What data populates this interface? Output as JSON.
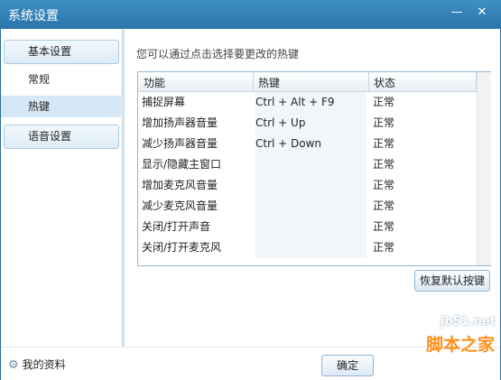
{
  "window": {
    "title": "系统设置",
    "min_icon": "minimize-icon",
    "close_icon": "close-icon"
  },
  "sidebar": {
    "group_basic": "基本设置",
    "items": [
      "常规",
      "热键"
    ],
    "group_voice": "语音设置",
    "selected": "热键"
  },
  "main": {
    "hint": "您可以通过点击选择要更改的热键",
    "table": {
      "headers": [
        "功能",
        "热键",
        "状态"
      ],
      "rows": [
        {
          "function": "捕捉屏幕",
          "hotkey": "Ctrl + Alt + F9",
          "status": "正常"
        },
        {
          "function": "增加扬声器音量",
          "hotkey": "Ctrl + Up",
          "status": "正常"
        },
        {
          "function": "减少扬声器音量",
          "hotkey": "Ctrl + Down",
          "status": "正常"
        },
        {
          "function": "显示/隐藏主窗口",
          "hotkey": "",
          "status": "正常"
        },
        {
          "function": "增加麦克风音量",
          "hotkey": "",
          "status": "正常"
        },
        {
          "function": "减少麦克风音量",
          "hotkey": "",
          "status": "正常"
        },
        {
          "function": "关闭/打开声音",
          "hotkey": "",
          "status": "正常"
        },
        {
          "function": "关闭/打开麦克风",
          "hotkey": "",
          "status": "正常"
        }
      ]
    },
    "restore_button": "恢复默认按键"
  },
  "footer": {
    "profile_link": "我的资料",
    "profile_icon": "gear-icon",
    "ok_button": "确定"
  },
  "watermark": {
    "line1": "jb51.net",
    "line2": "脚本之家"
  },
  "colors": {
    "titlebar": "#2a75ab",
    "selected_item": "#d6e8f6",
    "watermark": "#ff8f1a"
  }
}
